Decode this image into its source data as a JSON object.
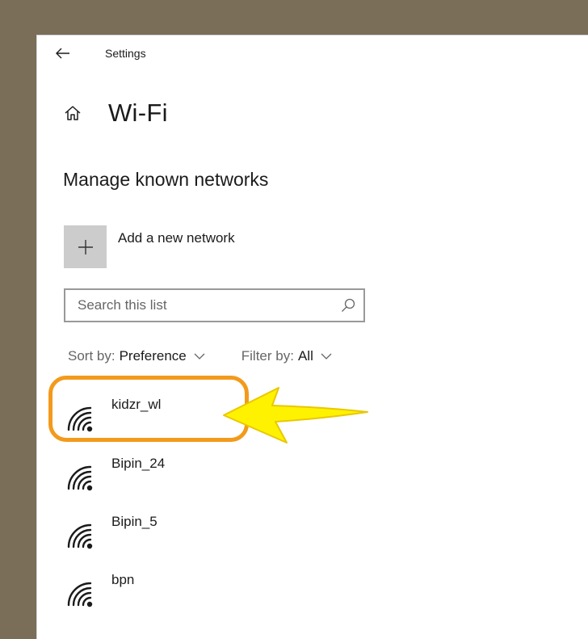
{
  "window": {
    "title": "Settings"
  },
  "header": {
    "page_title": "Wi-Fi"
  },
  "section": {
    "title": "Manage known networks"
  },
  "add_network": {
    "label": "Add a new network"
  },
  "search": {
    "placeholder": "Search this list",
    "value": ""
  },
  "sort": {
    "label": "Sort by:",
    "value": "Preference"
  },
  "filter": {
    "label": "Filter by:",
    "value": "All"
  },
  "networks": [
    {
      "name": "kidzr_wl"
    },
    {
      "name": "Bipin_24"
    },
    {
      "name": "Bipin_5"
    },
    {
      "name": "bpn"
    }
  ],
  "icons": {
    "back": "back-arrow-icon",
    "home": "home-icon",
    "add": "plus-icon",
    "search": "search-icon",
    "chevron": "chevron-down-icon",
    "wifi": "wifi-icon"
  },
  "colors": {
    "highlight_ring": "#f39a1c",
    "arrow_fill": "#fff200",
    "background": "#7a6e59"
  }
}
